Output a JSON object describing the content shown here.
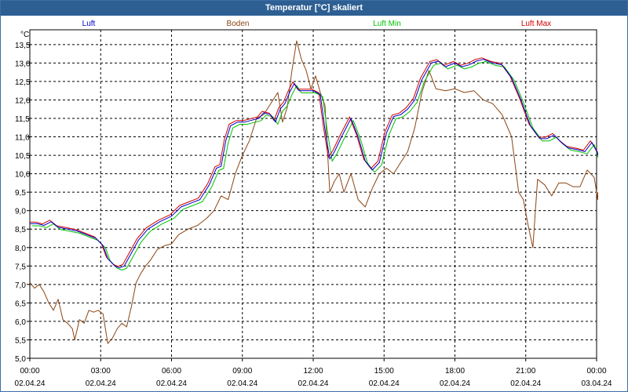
{
  "window": {
    "title": "Temperatur [°C] skaliert"
  },
  "colors": {
    "titlebar": "#2e5f93",
    "Luft": "#0000c8",
    "Boden": "#8b4513",
    "Luft Min": "#00c000",
    "Luft Max": "#d00000"
  },
  "chart_data": {
    "type": "line",
    "title": "Temperatur [°C] skaliert",
    "ylabel": "°C",
    "ylim": [
      5.0,
      13.9
    ],
    "yticks": [
      "5,0",
      "5,5",
      "6,0",
      "6,5",
      "7,0",
      "7,5",
      "8,0",
      "8,5",
      "9,0",
      "9,5",
      "10,0",
      "10,5",
      "11,0",
      "11,5",
      "12,0",
      "12,5",
      "13,0",
      "13,5"
    ],
    "xlim": [
      0,
      24
    ],
    "xticks": [
      {
        "time": "00:00",
        "date": "02.04.24"
      },
      {
        "time": "03:00",
        "date": "02.04.24"
      },
      {
        "time": "06:00",
        "date": "02.04.24"
      },
      {
        "time": "09:00",
        "date": "02.04.24"
      },
      {
        "time": "12:00",
        "date": "02.04.24"
      },
      {
        "time": "15:00",
        "date": "02.04.24"
      },
      {
        "time": "18:00",
        "date": "02.04.24"
      },
      {
        "time": "21:00",
        "date": "02.04.24"
      },
      {
        "time": "00:00",
        "date": "03.04.24"
      }
    ],
    "grid": true,
    "legend_position": "top",
    "x_unit": "hours since 02.04.24 00:00",
    "series": [
      {
        "name": "Luft",
        "color": "#0000c8",
        "points": [
          [
            0,
            8.65
          ],
          [
            0.3,
            8.65
          ],
          [
            0.6,
            8.6
          ],
          [
            0.9,
            8.7
          ],
          [
            1.2,
            8.55
          ],
          [
            1.6,
            8.5
          ],
          [
            2,
            8.45
          ],
          [
            2.4,
            8.35
          ],
          [
            2.8,
            8.25
          ],
          [
            3.1,
            8.05
          ],
          [
            3.3,
            7.7
          ],
          [
            3.6,
            7.5
          ],
          [
            3.8,
            7.45
          ],
          [
            4.0,
            7.5
          ],
          [
            4.3,
            7.85
          ],
          [
            4.6,
            8.2
          ],
          [
            5,
            8.5
          ],
          [
            5.5,
            8.7
          ],
          [
            6,
            8.85
          ],
          [
            6.4,
            9.1
          ],
          [
            6.8,
            9.2
          ],
          [
            7.2,
            9.3
          ],
          [
            7.6,
            9.7
          ],
          [
            7.9,
            10.15
          ],
          [
            8.1,
            10.2
          ],
          [
            8.3,
            10.9
          ],
          [
            8.5,
            11.3
          ],
          [
            8.8,
            11.4
          ],
          [
            9.1,
            11.4
          ],
          [
            9.4,
            11.45
          ],
          [
            9.7,
            11.5
          ],
          [
            9.9,
            11.65
          ],
          [
            10.2,
            11.6
          ],
          [
            10.4,
            11.4
          ],
          [
            10.6,
            11.75
          ],
          [
            10.8,
            11.9
          ],
          [
            11,
            12.2
          ],
          [
            11.2,
            12.45
          ],
          [
            11.4,
            12.25
          ],
          [
            11.7,
            12.25
          ],
          [
            12,
            12.25
          ],
          [
            12.3,
            12.15
          ],
          [
            12.5,
            11.2
          ],
          [
            12.7,
            10.4
          ],
          [
            12.9,
            10.6
          ],
          [
            13.2,
            11.0
          ],
          [
            13.6,
            11.5
          ],
          [
            13.9,
            11.0
          ],
          [
            14.2,
            10.35
          ],
          [
            14.5,
            10.1
          ],
          [
            14.8,
            10.3
          ],
          [
            15.1,
            11.1
          ],
          [
            15.4,
            11.55
          ],
          [
            15.7,
            11.6
          ],
          [
            16,
            11.75
          ],
          [
            16.3,
            12.0
          ],
          [
            16.6,
            12.55
          ],
          [
            17,
            13.0
          ],
          [
            17.3,
            13.05
          ],
          [
            17.6,
            12.9
          ],
          [
            18,
            13.0
          ],
          [
            18.3,
            12.9
          ],
          [
            18.6,
            12.95
          ],
          [
            18.9,
            13.05
          ],
          [
            19.2,
            13.1
          ],
          [
            19.6,
            13.0
          ],
          [
            20,
            12.95
          ],
          [
            20.4,
            12.6
          ],
          [
            20.8,
            12.0
          ],
          [
            21.2,
            11.3
          ],
          [
            21.6,
            10.95
          ],
          [
            21.9,
            10.95
          ],
          [
            22.2,
            11.05
          ],
          [
            22.5,
            10.85
          ],
          [
            22.8,
            10.7
          ],
          [
            23.2,
            10.65
          ],
          [
            23.5,
            10.6
          ],
          [
            23.8,
            10.85
          ],
          [
            24.1,
            10.55
          ],
          [
            24.4,
            10.5
          ],
          [
            24.6,
            10.5
          ]
        ]
      },
      {
        "name": "Boden",
        "color": "#8b4513",
        "points": [
          [
            0,
            7.05
          ],
          [
            0.2,
            6.9
          ],
          [
            0.4,
            7.0
          ],
          [
            0.6,
            6.8
          ],
          [
            0.8,
            6.5
          ],
          [
            1.0,
            6.3
          ],
          [
            1.2,
            6.6
          ],
          [
            1.4,
            6.05
          ],
          [
            1.6,
            5.95
          ],
          [
            1.8,
            5.8
          ],
          [
            1.9,
            5.5
          ],
          [
            2.1,
            6.05
          ],
          [
            2.3,
            5.95
          ],
          [
            2.5,
            6.3
          ],
          [
            2.7,
            6.25
          ],
          [
            2.9,
            6.3
          ],
          [
            3.1,
            6.2
          ],
          [
            3.3,
            5.4
          ],
          [
            3.5,
            5.55
          ],
          [
            3.7,
            5.8
          ],
          [
            3.9,
            5.95
          ],
          [
            4.1,
            5.85
          ],
          [
            4.3,
            6.4
          ],
          [
            4.5,
            7.05
          ],
          [
            4.7,
            7.3
          ],
          [
            4.9,
            7.5
          ],
          [
            5.1,
            7.65
          ],
          [
            5.4,
            7.95
          ],
          [
            5.7,
            8.05
          ],
          [
            6.0,
            8.1
          ],
          [
            6.3,
            8.35
          ],
          [
            6.7,
            8.5
          ],
          [
            7.1,
            8.6
          ],
          [
            7.5,
            8.8
          ],
          [
            7.8,
            9.0
          ],
          [
            8.1,
            9.4
          ],
          [
            8.4,
            9.3
          ],
          [
            8.7,
            10.0
          ],
          [
            9,
            10.5
          ],
          [
            9.3,
            10.9
          ],
          [
            9.6,
            11.5
          ],
          [
            9.9,
            11.6
          ],
          [
            10.1,
            11.8
          ],
          [
            10.3,
            12.0
          ],
          [
            10.5,
            12.2
          ],
          [
            10.7,
            11.4
          ],
          [
            10.9,
            11.8
          ],
          [
            11.1,
            12.8
          ],
          [
            11.3,
            13.6
          ],
          [
            11.5,
            13.1
          ],
          [
            11.7,
            12.8
          ],
          [
            11.9,
            12.3
          ],
          [
            12.1,
            12.65
          ],
          [
            12.3,
            12.2
          ],
          [
            12.5,
            11.85
          ],
          [
            12.7,
            9.5
          ],
          [
            12.9,
            9.8
          ],
          [
            13.1,
            10.0
          ],
          [
            13.3,
            9.5
          ],
          [
            13.6,
            10.0
          ],
          [
            13.9,
            9.3
          ],
          [
            14.2,
            9.1
          ],
          [
            14.5,
            9.6
          ],
          [
            14.8,
            10.0
          ],
          [
            15.1,
            10.15
          ],
          [
            15.4,
            10.0
          ],
          [
            15.7,
            10.3
          ],
          [
            16,
            10.6
          ],
          [
            16.3,
            11.25
          ],
          [
            16.6,
            12.2
          ],
          [
            16.9,
            12.8
          ],
          [
            17.2,
            12.3
          ],
          [
            17.6,
            12.25
          ],
          [
            18,
            12.3
          ],
          [
            18.4,
            12.2
          ],
          [
            18.8,
            12.25
          ],
          [
            19.2,
            12.0
          ],
          [
            19.6,
            11.9
          ],
          [
            20,
            11.6
          ],
          [
            20.4,
            11.0
          ],
          [
            20.7,
            9.5
          ],
          [
            20.9,
            9.3
          ],
          [
            21.1,
            8.6
          ],
          [
            21.3,
            8.0
          ],
          [
            21.5,
            9.85
          ],
          [
            21.8,
            9.7
          ],
          [
            22.1,
            9.4
          ],
          [
            22.4,
            9.75
          ],
          [
            22.7,
            9.75
          ],
          [
            23.0,
            9.65
          ],
          [
            23.3,
            9.65
          ],
          [
            23.6,
            10.1
          ],
          [
            23.9,
            9.9
          ],
          [
            24.1,
            9.3
          ],
          [
            24.3,
            9.3
          ],
          [
            24.6,
            9.5
          ]
        ]
      }
    ],
    "offset_series": [
      {
        "name": "Luft Min",
        "color": "#00c000",
        "base": "Luft",
        "delta_x": 0.1,
        "delta_y": -0.06
      },
      {
        "name": "Luft Max",
        "color": "#d00000",
        "base": "Luft",
        "delta_x": -0.06,
        "delta_y": 0.04
      }
    ]
  }
}
